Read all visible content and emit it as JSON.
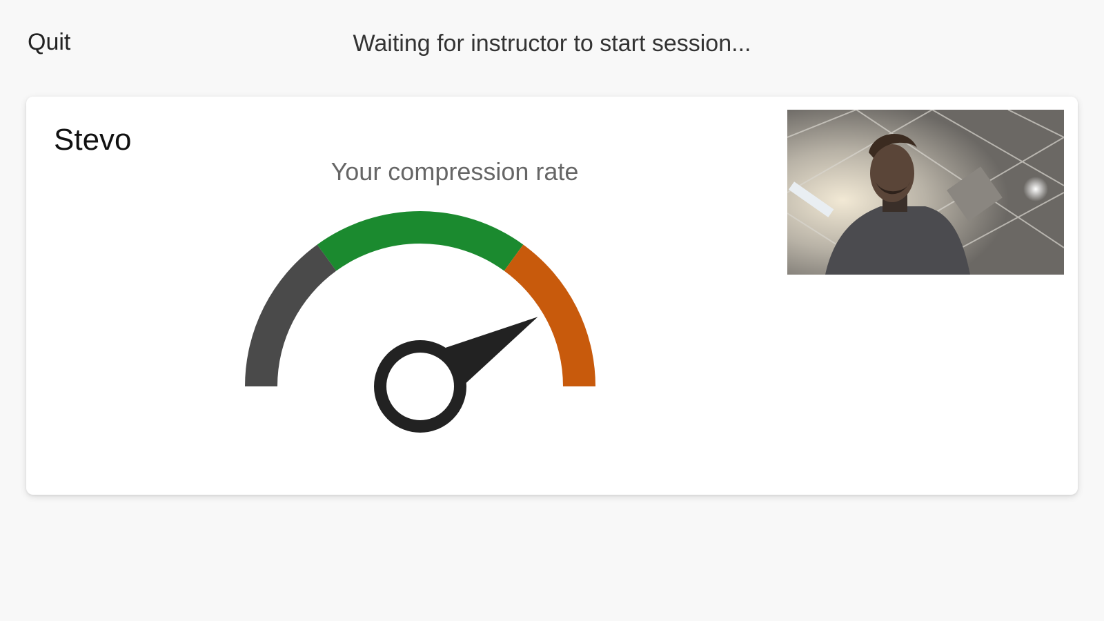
{
  "header": {
    "quit_label": "Quit",
    "status": "Waiting for instructor to start session..."
  },
  "card": {
    "participant_name": "Stevo",
    "gauge": {
      "title": "Your compression rate",
      "needle_fraction": 0.83,
      "zones": [
        {
          "name": "low",
          "from": 0.0,
          "to": 0.3,
          "color": "#4a4a4a"
        },
        {
          "name": "target",
          "from": 0.3,
          "to": 0.7,
          "color": "#1b8a2f"
        },
        {
          "name": "high",
          "from": 0.7,
          "to": 1.0,
          "color": "#c85a0c"
        }
      ],
      "needle_color": "#222222"
    },
    "video": {
      "icon": "webcam-feed"
    }
  }
}
